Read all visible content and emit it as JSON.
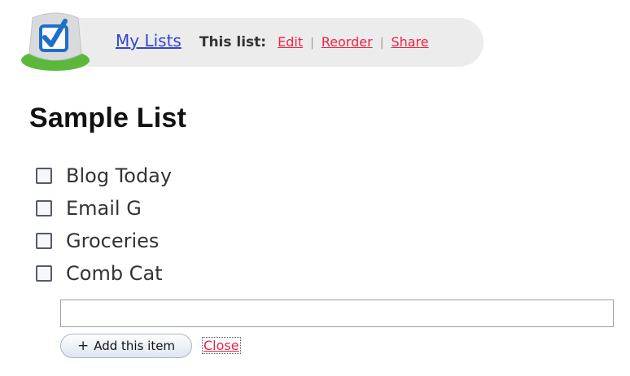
{
  "header": {
    "logo_icon": "checkmark-badge-icon",
    "my_lists": "My Lists",
    "this_list_label": "This list:",
    "links": [
      {
        "label": "Edit"
      },
      {
        "label": "Reorder"
      },
      {
        "label": "Share"
      }
    ],
    "separator": "|"
  },
  "list": {
    "title": "Sample List",
    "items": [
      {
        "label": "Blog Today",
        "checked": false
      },
      {
        "label": "Email G",
        "checked": false
      },
      {
        "label": "Groceries",
        "checked": false
      },
      {
        "label": "Comb Cat",
        "checked": false
      }
    ]
  },
  "add_item": {
    "input_value": "",
    "button_icon": "plus-icon",
    "button_plus": "+",
    "button_label": "Add this item",
    "close_label": "Close"
  },
  "colors": {
    "link_blue": "#3344cc",
    "link_red": "#ee2244",
    "header_bg": "#ececec",
    "logo_green": "#5cb83c",
    "logo_blue": "#1e6fc7"
  }
}
